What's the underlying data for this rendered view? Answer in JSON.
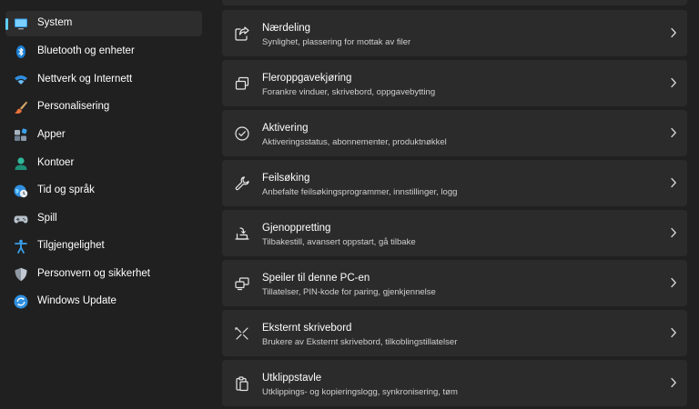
{
  "sidebar": {
    "items": [
      {
        "label": "System",
        "icon": "monitor-icon"
      },
      {
        "label": "Bluetooth og enheter",
        "icon": "bluetooth-icon"
      },
      {
        "label": "Nettverk og Internett",
        "icon": "wifi-icon"
      },
      {
        "label": "Personalisering",
        "icon": "brush-icon"
      },
      {
        "label": "Apper",
        "icon": "apps-icon"
      },
      {
        "label": "Kontoer",
        "icon": "account-icon"
      },
      {
        "label": "Tid og språk",
        "icon": "globe-clock-icon"
      },
      {
        "label": "Spill",
        "icon": "gamepad-icon"
      },
      {
        "label": "Tilgjengelighet",
        "icon": "accessibility-icon"
      },
      {
        "label": "Personvern og sikkerhet",
        "icon": "shield-icon"
      },
      {
        "label": "Windows Update",
        "icon": "update-icon"
      }
    ],
    "selected": "System"
  },
  "main": {
    "cards": [
      {
        "title": "Nærdeling",
        "subtitle": "Synlighet, plassering for mottak av filer",
        "icon": "share-icon"
      },
      {
        "title": "Fleroppgavekjøring",
        "subtitle": "Forankre vinduer, skrivebord, oppgavebytting",
        "icon": "multitasking-icon"
      },
      {
        "title": "Aktivering",
        "subtitle": "Aktiveringsstatus, abonnementer, produktnøkkel",
        "icon": "check-circle-icon"
      },
      {
        "title": "Feilsøking",
        "subtitle": "Anbefalte feilsøkingsprogrammer, innstillinger, logg",
        "icon": "wrench-icon"
      },
      {
        "title": "Gjenoppretting",
        "subtitle": "Tilbakestill, avansert oppstart, gå tilbake",
        "icon": "recovery-icon"
      },
      {
        "title": "Speiler til denne PC-en",
        "subtitle": "Tillatelser, PIN-kode for paring, gjenkjennelse",
        "icon": "projection-icon"
      },
      {
        "title": "Eksternt skrivebord",
        "subtitle": "Brukere av Eksternt skrivebord, tilkoblingstillatelser",
        "icon": "remote-desktop-icon"
      },
      {
        "title": "Utklippstavle",
        "subtitle": "Utklippings- og kopieringslogg, synkronisering, tøm",
        "icon": "clipboard-icon"
      }
    ]
  },
  "colors": {
    "background": "#202020",
    "card": "#2b2b2b",
    "selected": "#2d2d2d",
    "accent": "#60cdff"
  }
}
